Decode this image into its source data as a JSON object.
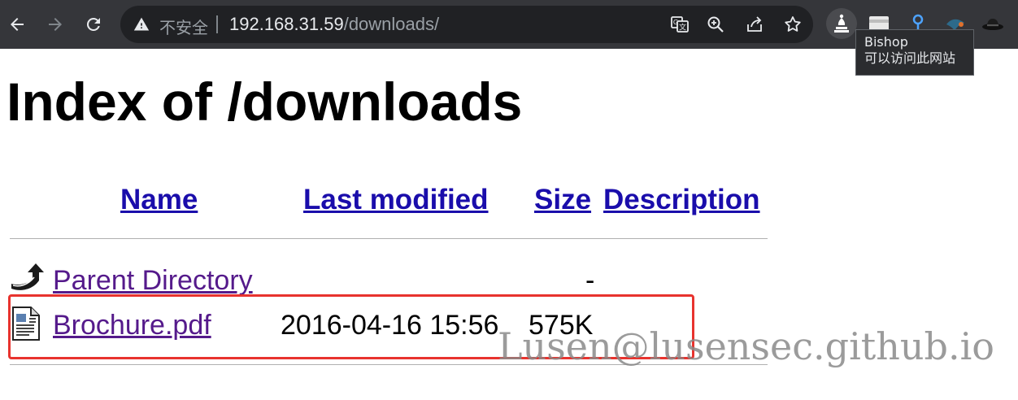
{
  "browser": {
    "security_label": "不安全",
    "url_host": "192.168.31.59",
    "url_path": "/downloads/",
    "tooltip_title": "Bishop",
    "tooltip_subtitle": "可以访问此网站"
  },
  "page": {
    "title": "Index of /downloads",
    "columns": {
      "name": "Name",
      "last_modified": "Last modified",
      "size": "Size",
      "description": "Description"
    },
    "rows": [
      {
        "name": "Parent Directory",
        "last_modified": "",
        "size": "-",
        "icon": "back-arrow-icon"
      },
      {
        "name": "Brochure.pdf",
        "last_modified": "2016-04-16 15:56",
        "size": "575K",
        "icon": "document-icon"
      }
    ]
  },
  "watermark": "Lusen@lusensec.github.io",
  "colors": {
    "highlight_border": "#e8332e",
    "link": "#1a0dab",
    "visited_link": "#551a8b",
    "toolbar": "#35363a"
  }
}
